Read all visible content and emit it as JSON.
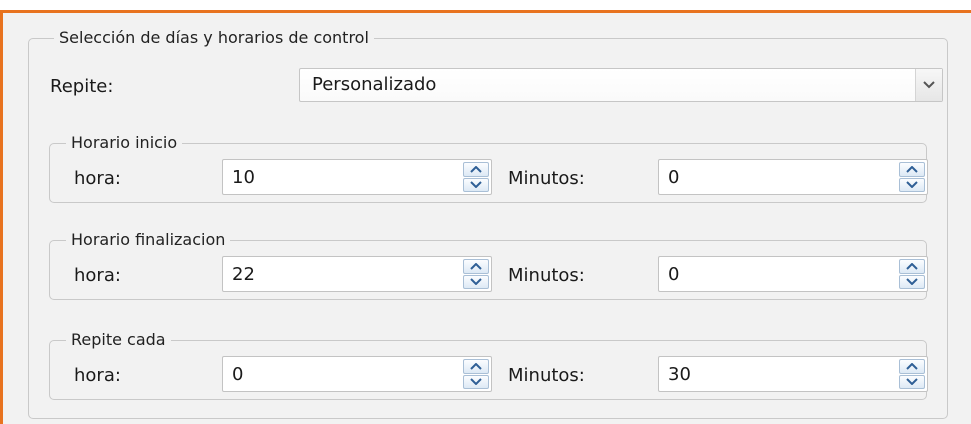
{
  "panel": {
    "title": "Selección de días y horarios de control",
    "repeat_label": "Repite:",
    "repeat_value": "Personalizado"
  },
  "groups": [
    {
      "title": "Horario inicio",
      "hour_label": "hora:",
      "hour_value": "10",
      "minutes_label": "Minutos:",
      "minutes_value": "0"
    },
    {
      "title": "Horario finalizacion",
      "hour_label": "hora:",
      "hour_value": "22",
      "minutes_label": "Minutos:",
      "minutes_value": "0"
    },
    {
      "title": "Repite cada",
      "hour_label": "hora:",
      "hour_value": "0",
      "minutes_label": "Minutos:",
      "minutes_value": "30"
    }
  ],
  "icons": {
    "dropdown": "chevron-down-icon",
    "spin_up": "arrow-up-icon",
    "spin_down": "arrow-down-icon"
  },
  "colors": {
    "accent_border": "#e8731f",
    "spin_arrow": "#2f5f96"
  }
}
